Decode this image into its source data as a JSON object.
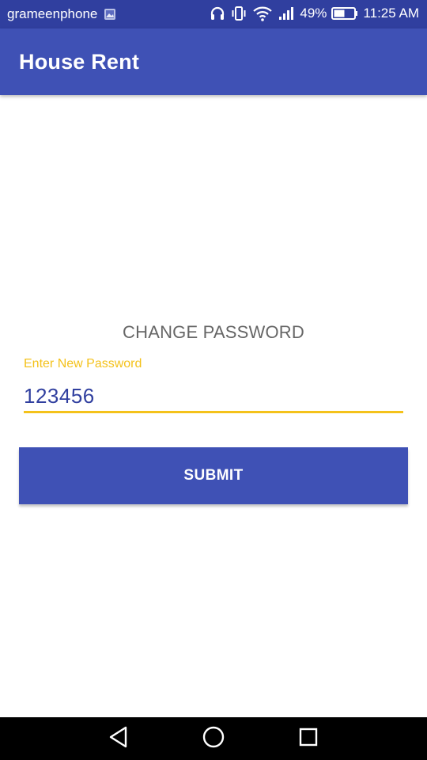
{
  "status_bar": {
    "carrier": "grameenphone",
    "battery_percent": "49%",
    "time": "11:25 AM",
    "icons": [
      "image-icon",
      "headphones-icon",
      "vibrate-icon",
      "wifi-icon",
      "signal-icon",
      "battery-icon"
    ]
  },
  "app_bar": {
    "title": "House Rent"
  },
  "form": {
    "heading": "CHANGE PASSWORD",
    "password_label": "Enter New Password",
    "password_value": "123456",
    "submit_label": "SUBMIT"
  },
  "nav_bar": {
    "buttons": [
      "back-icon",
      "home-icon",
      "recents-icon"
    ]
  },
  "colors": {
    "status_bar": "#303f9f",
    "primary": "#3f51b5",
    "accent": "#f4c21b",
    "input_text": "#303f9f",
    "heading_text": "#666666"
  }
}
